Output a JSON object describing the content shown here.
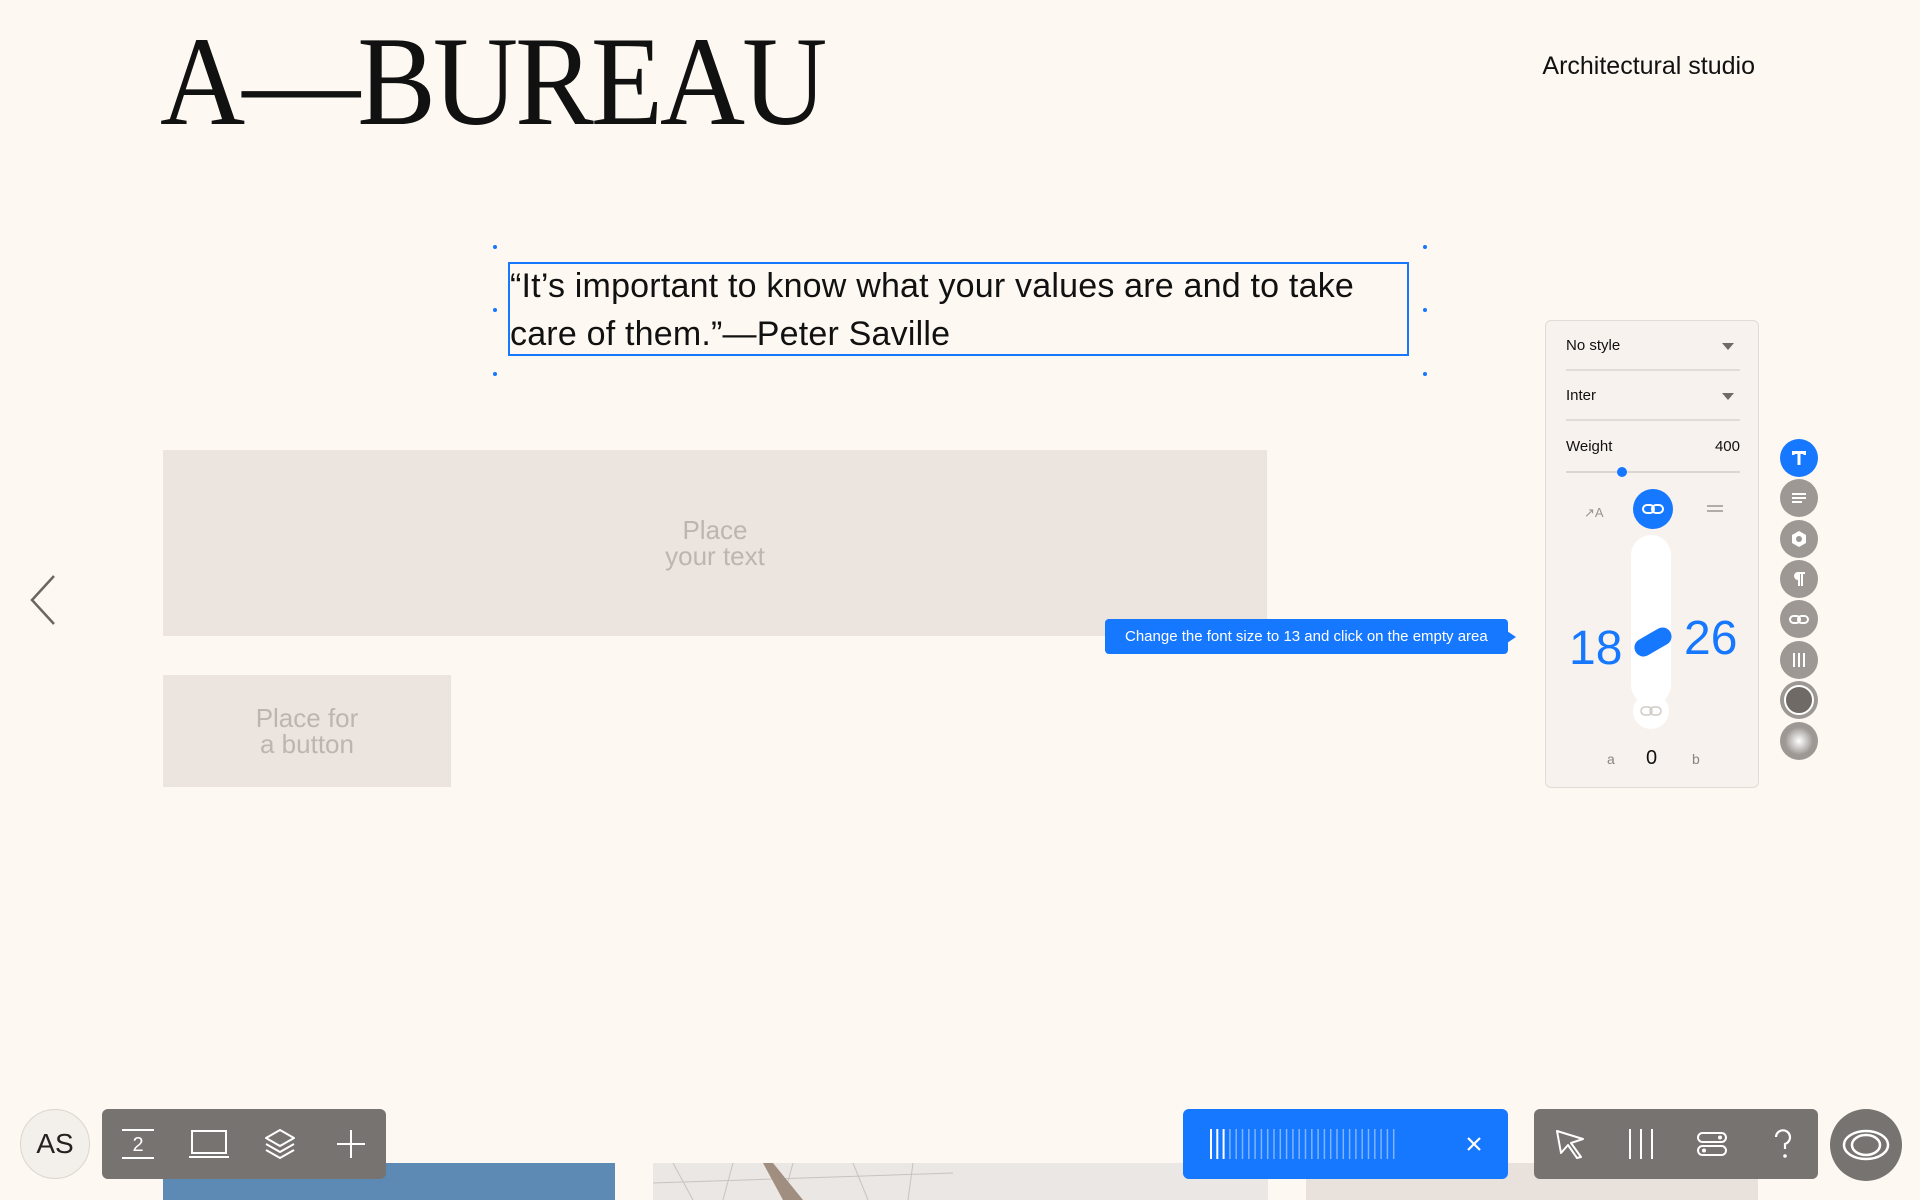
{
  "header": {
    "logo": "A—BUREAU",
    "tagline": "Architectural studio"
  },
  "canvas": {
    "quote": "“It’s important to know what your values are and to take care of them.”—Peter Saville",
    "text_placeholder": [
      "Place",
      "your text"
    ],
    "button_placeholder": [
      "Place for",
      "a button"
    ]
  },
  "tooltip": {
    "text": "Change the font size to 13 and click on the empty area"
  },
  "type_panel": {
    "style_select": "No style",
    "font_select": "Inter",
    "weight_label": "Weight",
    "weight_value": "400",
    "weight_fraction": 0.32,
    "case_label": "↗A",
    "size_min": "18",
    "size_max": "26",
    "label_a": "a",
    "label_b": "b",
    "offset_value": "0"
  },
  "side_tools": [
    "text-icon",
    "align-icon",
    "shape-icon",
    "paragraph-icon",
    "link-icon",
    "columns-icon",
    "fill-color-icon",
    "gradient-icon"
  ],
  "bottom_bar": {
    "avatar_initials": "AS",
    "page_number": "2",
    "colors": {
      "accent": "#1677ff",
      "toolbar": "#767370",
      "background": "#fdf8f1"
    }
  }
}
